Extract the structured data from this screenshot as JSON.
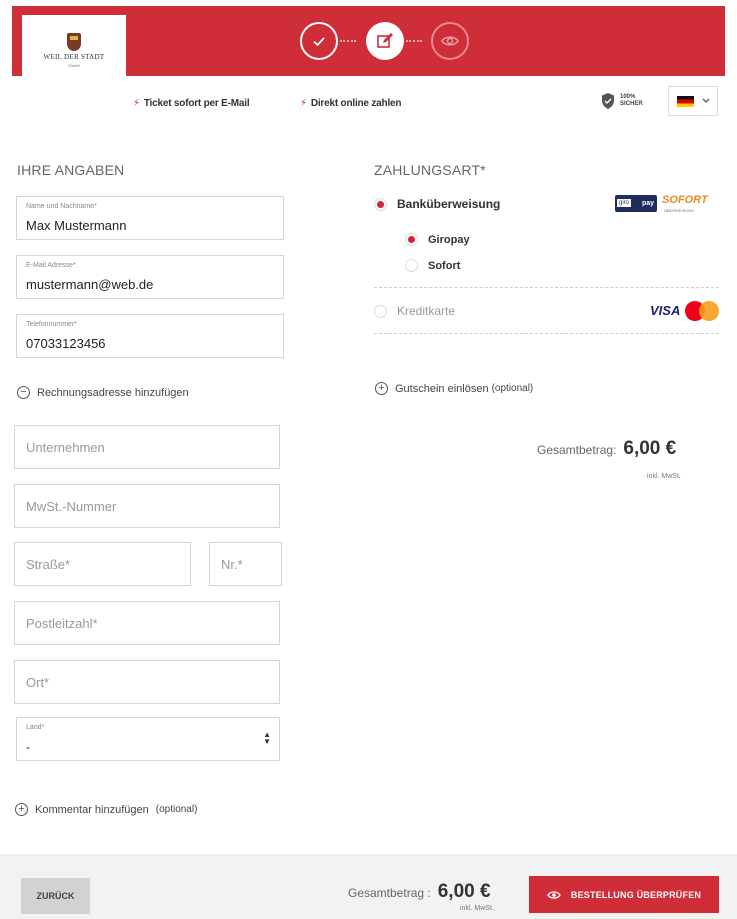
{
  "header": {
    "logo_name": "WEIL DER STADT",
    "logo_sub": "Eintritt",
    "steps": [
      "check-icon",
      "edit-icon",
      "eye-icon"
    ]
  },
  "features": [
    "Ticket sofort per E-Mail",
    "Direkt online zahlen"
  ],
  "secure_badge": [
    "100%",
    "SICHER"
  ],
  "language": {
    "flag": "de-flag-icon"
  },
  "personal": {
    "title": "IHRE ANGABEN",
    "name": {
      "label": "Name und Nachname*",
      "value": "Max Mustermann"
    },
    "email": {
      "label": "E-Mail Adresse*",
      "value": "mustermann@web.de"
    },
    "phone": {
      "label": "Telefonnummer*",
      "value": "07033123456"
    },
    "billing_toggle": "Rechnungsadresse hinzufügen",
    "company_placeholder": "Unternehmen",
    "vat_placeholder": "MwSt.-Nummer",
    "street_placeholder": "Straße*",
    "number_placeholder": "Nr.*",
    "zip_placeholder": "Postleitzahl*",
    "city_placeholder": "Ort*",
    "country": {
      "label": "Land*",
      "value": "-"
    },
    "comment_toggle": "Kommentar hinzufügen",
    "comment_optional": "(optional)"
  },
  "payment": {
    "title": "ZAHLUNGSART*",
    "bank_transfer": "Banküberweisung",
    "giropay": "Giropay",
    "sofort": "Sofort",
    "credit_card": "Kreditkarte",
    "voucher": "Gutschein einlösen",
    "voucher_optional": "(optional)",
    "brands": {
      "giropay_left": "giro",
      "giropay_right": "pay",
      "sofort": "SOFORT",
      "sofort_sub": "ÜBERWEISUNG",
      "visa": "VISA"
    }
  },
  "summary": {
    "total_label": "Gesamtbetrag:",
    "total_amount": "6,00 €",
    "vat_note": "inkl. MwSt."
  },
  "footer": {
    "back_label": "ZURÜCK",
    "total_label": "Gesamtbetrag :",
    "total_amount": "6,00 €",
    "vat_note": "inkl. MwSt.",
    "review_label": "BESTELLUNG ÜBERPRÜFEN"
  },
  "colors": {
    "brand": "#cf2d37",
    "accent": "#d3233a"
  }
}
